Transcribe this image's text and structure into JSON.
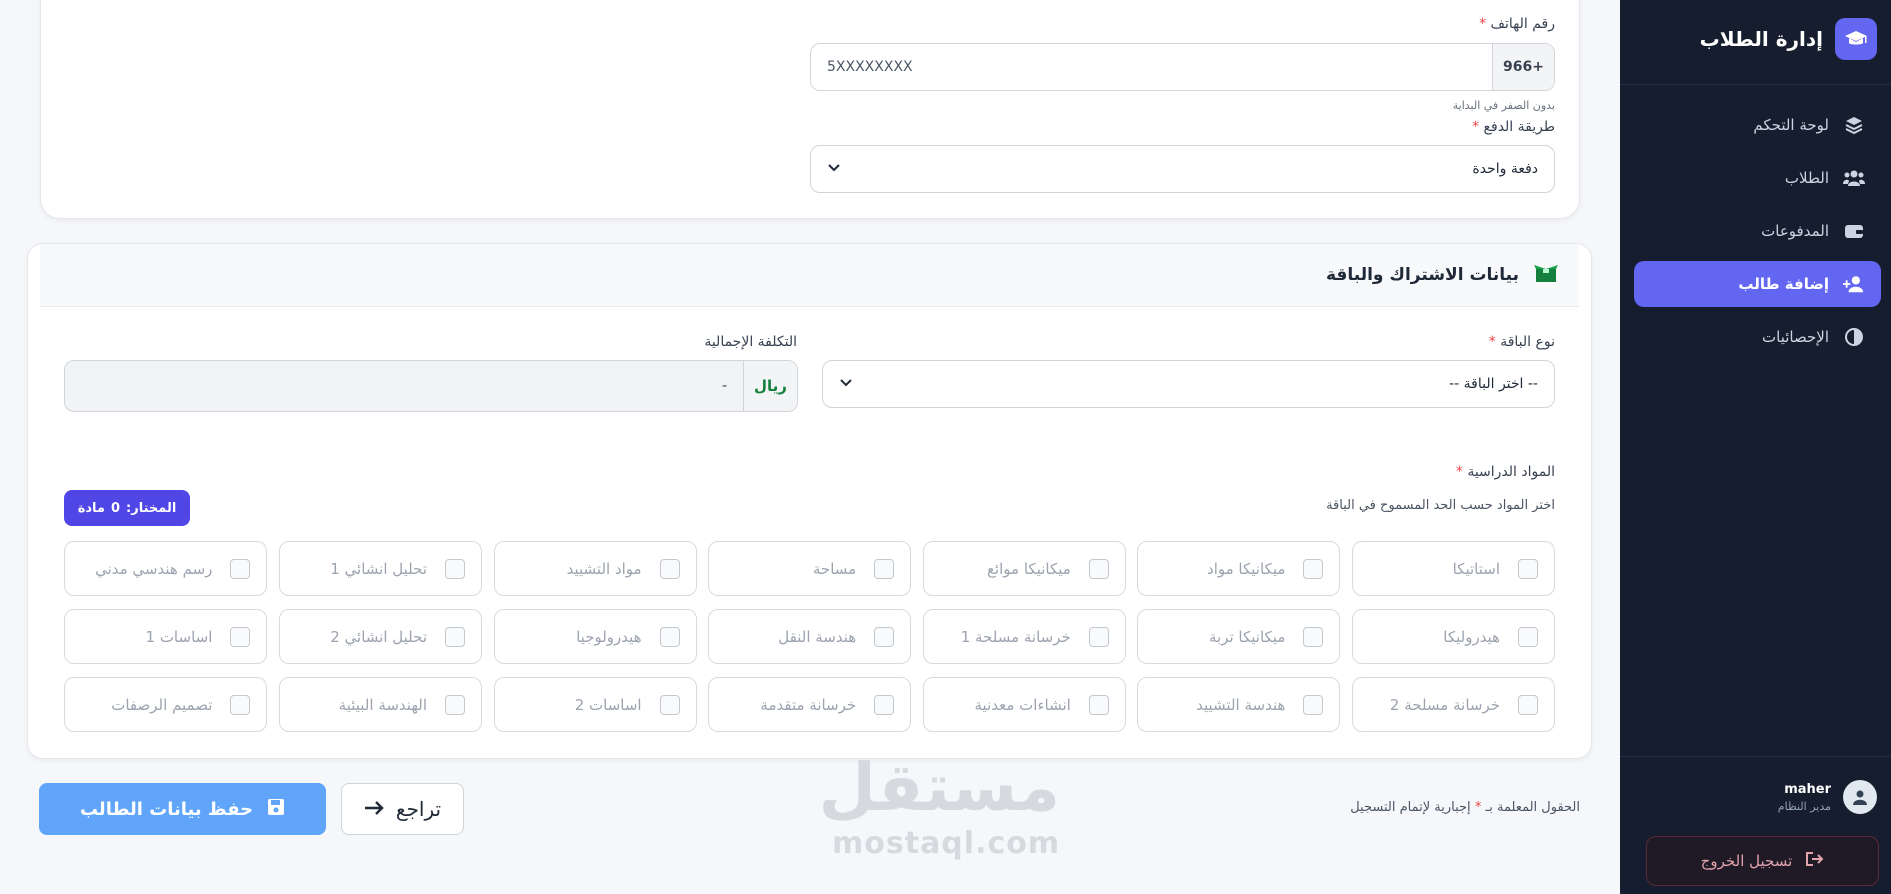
{
  "sidebar": {
    "brand_title": "إدارة الطلاب",
    "items": [
      {
        "label": "لوحة التحكم",
        "icon": "layers-icon"
      },
      {
        "label": "الطلاب",
        "icon": "users-icon"
      },
      {
        "label": "المدفوعات",
        "icon": "wallet-icon"
      },
      {
        "label": "إضافة طالب",
        "icon": "user-plus-icon",
        "active": true
      },
      {
        "label": "الإحصائيات",
        "icon": "pie-chart-icon"
      }
    ],
    "user": {
      "name": "maher",
      "role": "مدير النظام"
    },
    "logout_label": "تسجيل الخروج"
  },
  "contact": {
    "phone_label": "رقم الهاتف",
    "phone_code": "966+",
    "phone_value": "5XXXXXXXX",
    "phone_hint": "بدون الصفر في البداية",
    "payment_label": "طريقة الدفع",
    "payment_value": "دفعة واحدة"
  },
  "subscription": {
    "title": "بيانات الاشتراك والباقة",
    "package_label": "نوع الباقة",
    "package_placeholder": "-- اختر الباقة --",
    "cost_label": "التكلفة الإجمالية",
    "cost_value": "-",
    "cost_currency": "ريال",
    "subjects_label": "المواد الدراسية",
    "subjects_hint": "اختر المواد حسب الحد المسموح في الباقة",
    "selected_label": "المختار:",
    "selected_count": "0",
    "selected_unit": "مادة",
    "subjects": [
      "استاتيكا",
      "ميكانيكا مواد",
      "ميكانيكا موائع",
      "مساحة",
      "مواد التشييد",
      "تحليل انشائي 1",
      "رسم هندسي مدني",
      "هيدروليكا",
      "ميكانيكا تربة",
      "خرسانة مسلحة 1",
      "هندسة النقل",
      "هيدرولوجيا",
      "تحليل انشائي 2",
      "اساسات 1",
      "خرسانة مسلحة 2",
      "هندسة التشييد",
      "انشاءات معدنية",
      "خرسانة متقدمة",
      "اساسات 2",
      "الهندسة البيئية",
      "تصميم الرصفات"
    ]
  },
  "actions": {
    "save_label": "حفظ بيانات الطالب",
    "back_label": "تراجع",
    "required_note_a": "الحقول المعلمة بـ",
    "required_note_b": "إجبارية لإتمام التسجيل"
  },
  "watermark": {
    "ar": "مستقل",
    "en": "mostaql.com"
  },
  "colors": {
    "primary": "#6366f1",
    "sidebar_bg": "#151d2e",
    "save_button": "#60a5fa",
    "currency": "#15803d"
  }
}
